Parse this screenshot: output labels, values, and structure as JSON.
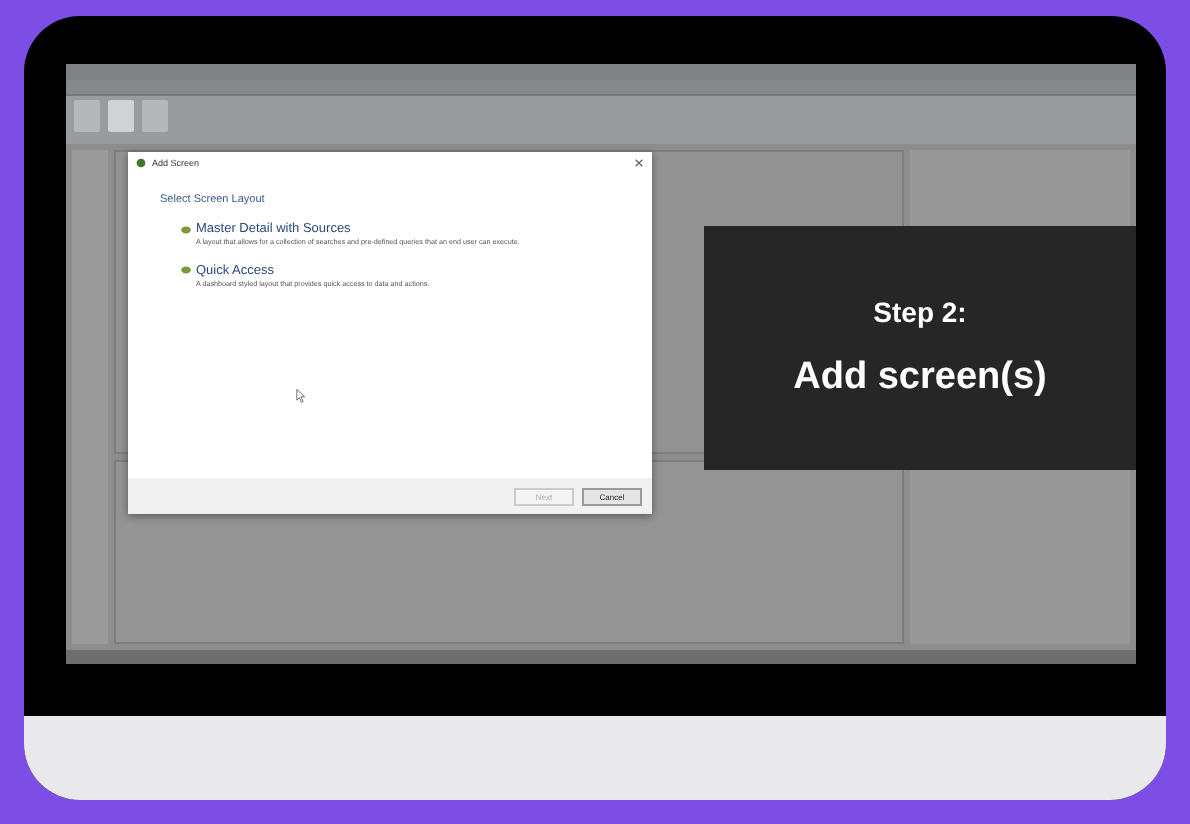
{
  "video": {
    "dialog": {
      "title": "Add Screen",
      "heading": "Select Screen Layout",
      "options": [
        {
          "title": "Master Detail with Sources",
          "description": "A layout that allows for a collection of searches and pre-defined queries that an end user can execute."
        },
        {
          "title": "Quick Access",
          "description": "A dashboard styled layout that provides quick access to data and actions."
        }
      ],
      "buttons": [
        {
          "label": "Next",
          "disabled": true
        },
        {
          "label": "Cancel",
          "disabled": false
        }
      ]
    },
    "overlay": {
      "step": "Step 2:",
      "caption": "Add screen(s)"
    }
  }
}
